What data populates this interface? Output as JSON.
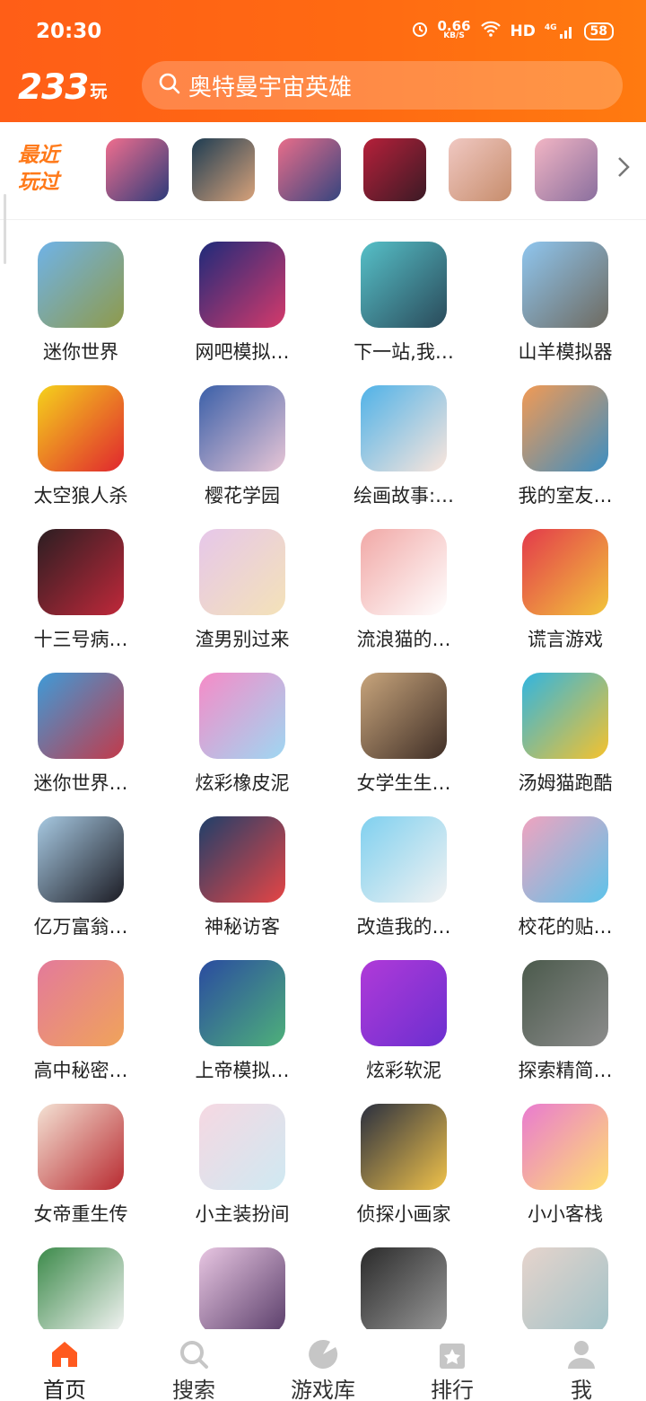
{
  "status": {
    "time": "20:30",
    "speed_value": "0.66",
    "speed_unit": "KB/S",
    "network": "HD",
    "signal_label": "4G",
    "battery": "58"
  },
  "header": {
    "logo_number": "233",
    "logo_char": "玩",
    "search_text": "奥特曼宇宙英雄",
    "search_icon": "search-icon"
  },
  "recent": {
    "label": "最近玩过",
    "more_icon": "chevron-right-icon",
    "items": [
      {
        "name": "recent-1",
        "colors": [
          "#f06e8e",
          "#2d3b7a"
        ]
      },
      {
        "name": "recent-2",
        "colors": [
          "#1d3c52",
          "#d8a27a"
        ]
      },
      {
        "name": "recent-3",
        "colors": [
          "#e86d8a",
          "#36457f"
        ]
      },
      {
        "name": "recent-4",
        "colors": [
          "#b6203a",
          "#3b1a25"
        ]
      },
      {
        "name": "recent-5",
        "colors": [
          "#f0c8c2",
          "#c78d6c"
        ]
      },
      {
        "name": "recent-6",
        "colors": [
          "#f2b5c4",
          "#8a6f9e"
        ]
      }
    ]
  },
  "games": [
    {
      "label": "迷你世界",
      "colors": [
        "#6fb3e8",
        "#8f9a4a"
      ]
    },
    {
      "label": "网吧模拟…",
      "colors": [
        "#1e2a7a",
        "#d53a6b"
      ]
    },
    {
      "label": "下一站,我…",
      "colors": [
        "#56c0c8",
        "#2a4a5a"
      ]
    },
    {
      "label": "山羊模拟器",
      "colors": [
        "#8fc6ef",
        "#6e6a60"
      ]
    },
    {
      "label": "太空狼人杀",
      "colors": [
        "#f5d21c",
        "#e0262e"
      ]
    },
    {
      "label": "樱花学园",
      "colors": [
        "#3a5fa8",
        "#e8c6d6"
      ]
    },
    {
      "label": "绘画故事:…",
      "colors": [
        "#4fb2e8",
        "#fbe6dc"
      ]
    },
    {
      "label": "我的室友…",
      "colors": [
        "#f29a54",
        "#3c8ec2"
      ]
    },
    {
      "label": "十三号病…",
      "colors": [
        "#2b1e22",
        "#c0283a"
      ]
    },
    {
      "label": "渣男别过来",
      "colors": [
        "#e6c7ea",
        "#f4e2b8"
      ]
    },
    {
      "label": "流浪猫的…",
      "colors": [
        "#f1a8a6",
        "#ffffff"
      ]
    },
    {
      "label": "谎言游戏",
      "colors": [
        "#e33a4b",
        "#f2c53b"
      ]
    },
    {
      "label": "迷你世界…",
      "colors": [
        "#3e9bd8",
        "#c23a4a"
      ]
    },
    {
      "label": "炫彩橡皮泥",
      "colors": [
        "#f68bc7",
        "#9ed7f2"
      ]
    },
    {
      "label": "女学生生…",
      "colors": [
        "#c8a57c",
        "#3f2e26"
      ]
    },
    {
      "label": "汤姆猫跑酷",
      "colors": [
        "#31b5e0",
        "#f5c22d"
      ]
    },
    {
      "label": "亿万富翁…",
      "colors": [
        "#a7c9e2",
        "#1c1c24"
      ]
    },
    {
      "label": "神秘访客",
      "colors": [
        "#1f3f6a",
        "#e64545"
      ]
    },
    {
      "label": "改造我的…",
      "colors": [
        "#7fd0ef",
        "#f2f2f2"
      ]
    },
    {
      "label": "校花的贴…",
      "colors": [
        "#f0a3bf",
        "#5cc3ea"
      ]
    },
    {
      "label": "高中秘密…",
      "colors": [
        "#e37a9b",
        "#f0a35a"
      ]
    },
    {
      "label": "上帝模拟…",
      "colors": [
        "#2a4ba0",
        "#4eb07a"
      ]
    },
    {
      "label": "炫彩软泥",
      "colors": [
        "#b03ad8",
        "#6b2fd0"
      ]
    },
    {
      "label": "探索精简…",
      "colors": [
        "#4b5a4c",
        "#8c8c8c"
      ]
    },
    {
      "label": "女帝重生传",
      "colors": [
        "#f4e2d4",
        "#b82a30"
      ]
    },
    {
      "label": "小主装扮间",
      "colors": [
        "#f6d8e2",
        "#cfe9f2"
      ]
    },
    {
      "label": "侦探小画家",
      "colors": [
        "#2a2f3f",
        "#f0c24a"
      ]
    },
    {
      "label": "小小客栈",
      "colors": [
        "#e97bd0",
        "#ffe070"
      ]
    },
    {
      "label": "",
      "colors": [
        "#3c8a4a",
        "#f4f4f4"
      ]
    },
    {
      "label": "",
      "colors": [
        "#e8c6e2",
        "#5a3e6a"
      ]
    },
    {
      "label": "",
      "colors": [
        "#2a2a2a",
        "#9a9a9a"
      ]
    },
    {
      "label": "",
      "colors": [
        "#e6d4cc",
        "#a0c2c8"
      ]
    }
  ],
  "tabs": [
    {
      "label": "首页",
      "icon": "home-icon",
      "active": true
    },
    {
      "label": "搜索",
      "icon": "search-icon",
      "active": false
    },
    {
      "label": "游戏库",
      "icon": "game-library-icon",
      "active": false
    },
    {
      "label": "排行",
      "icon": "ranking-icon",
      "active": false
    },
    {
      "label": "我",
      "icon": "profile-icon",
      "active": false
    }
  ],
  "colors": {
    "brand": "#ff6314",
    "active_tab": "#ff5a1f",
    "inactive_tab": "#c6c6c6"
  }
}
